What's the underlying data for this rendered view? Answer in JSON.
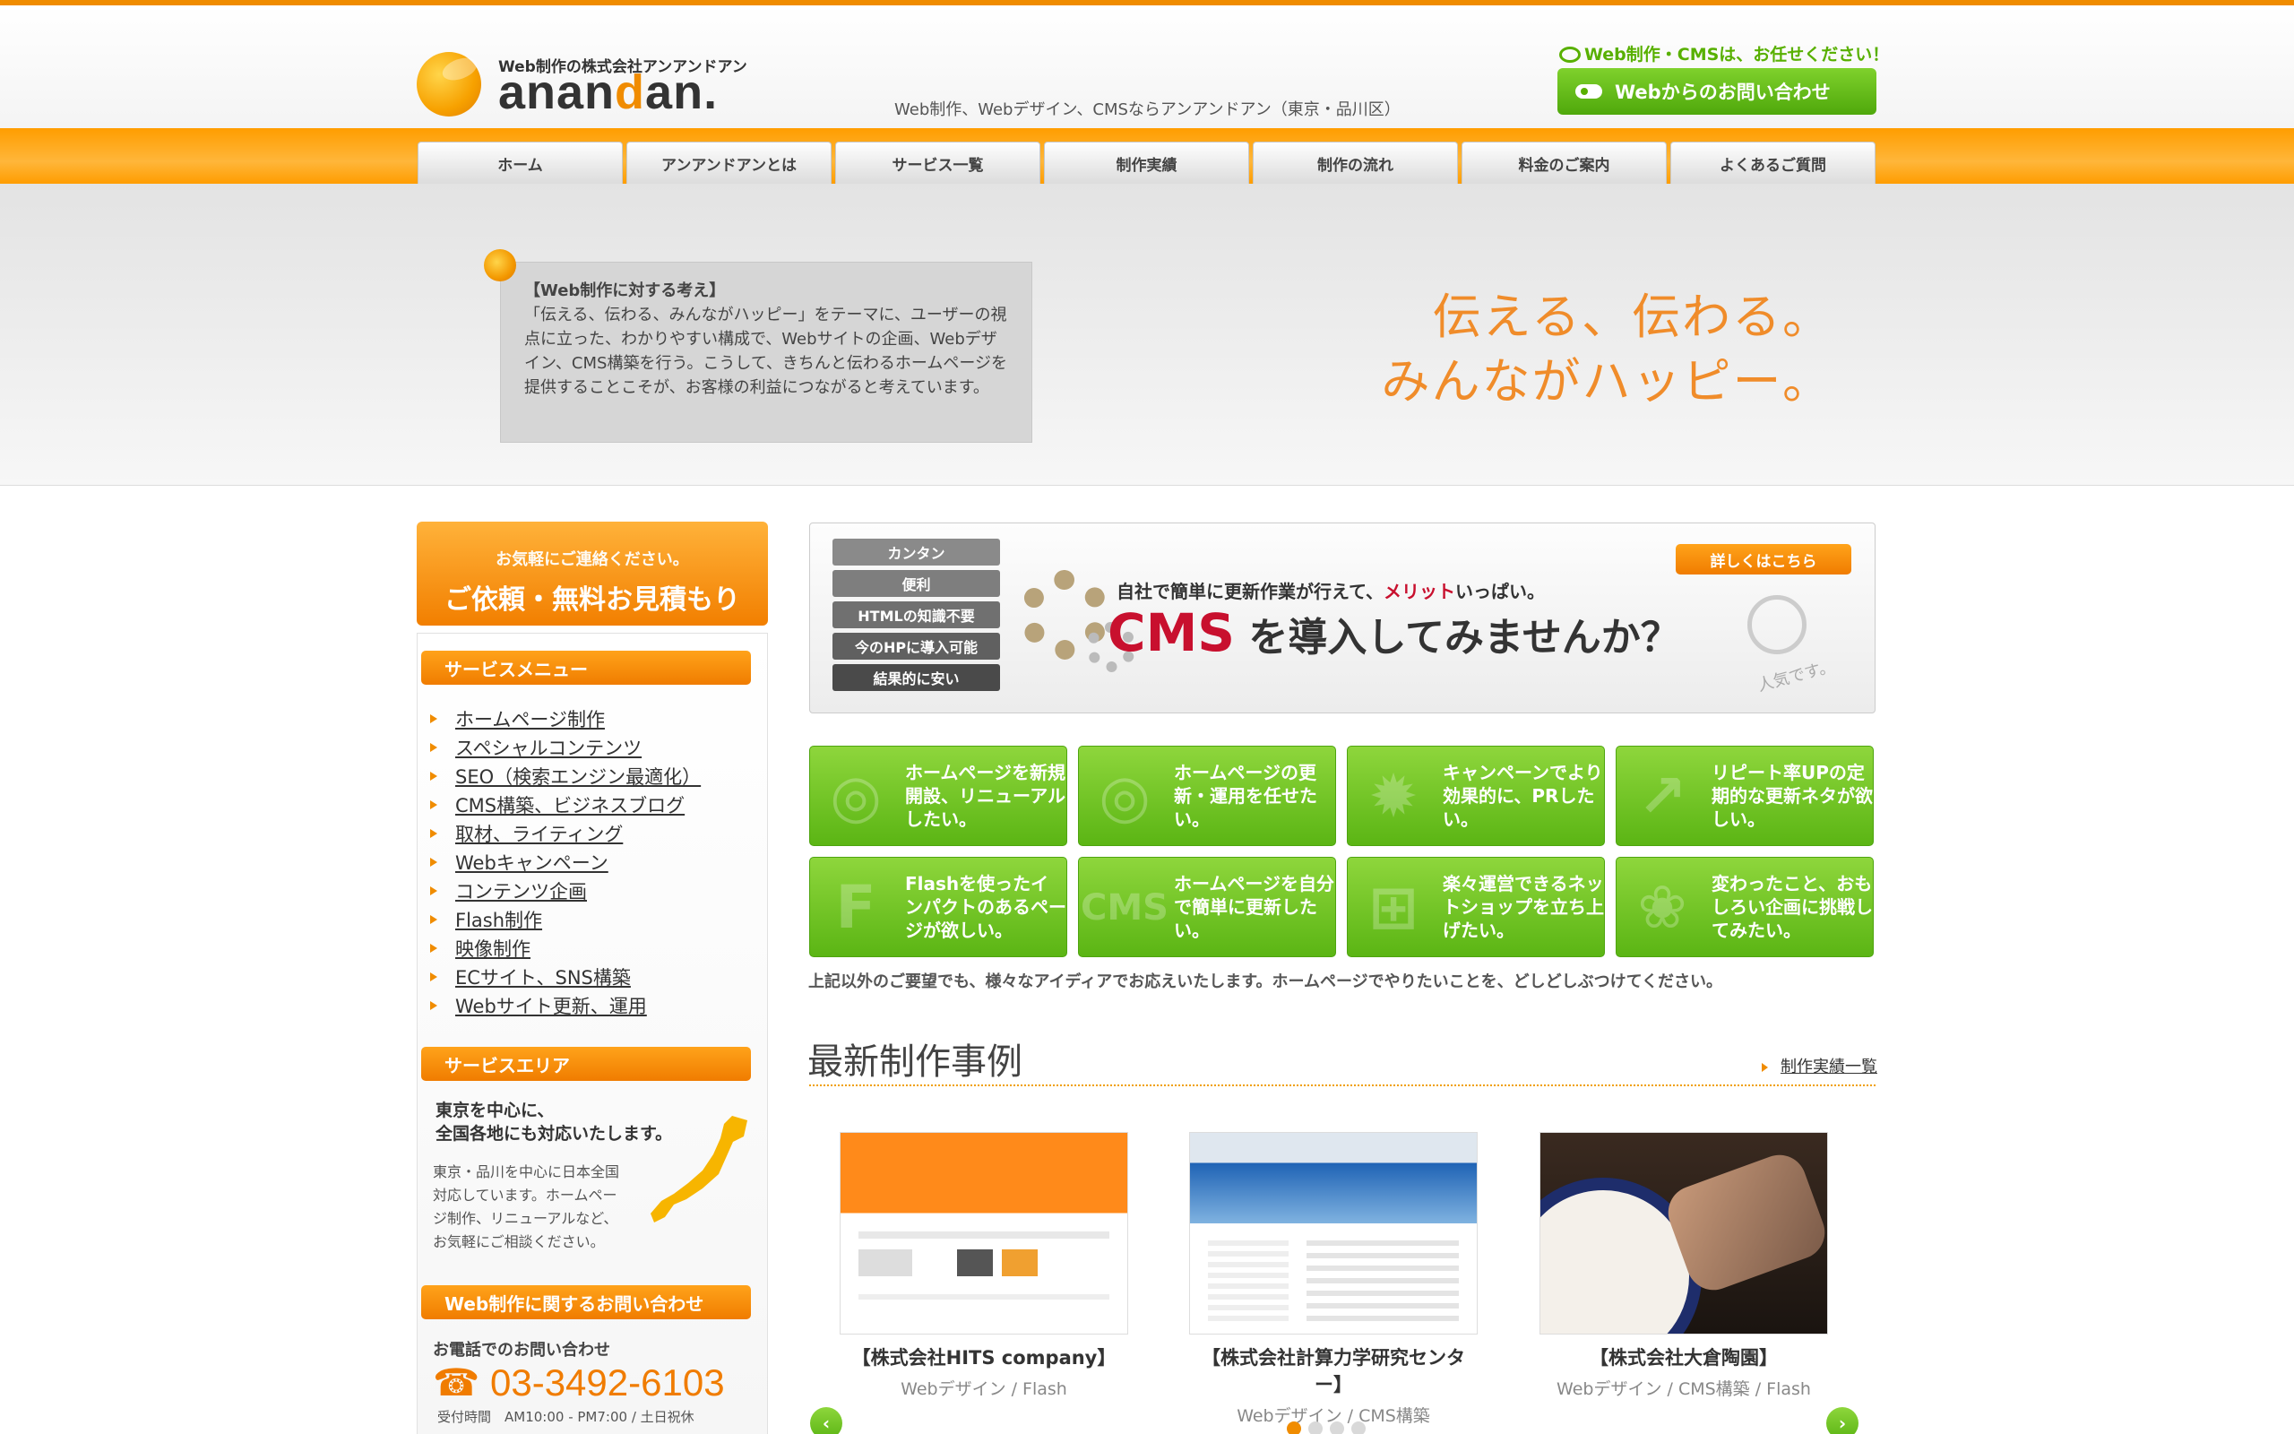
{
  "header": {
    "logo_tagline": "Web制作の株式会社アンアンドアン",
    "logo_part1": "anan",
    "logo_part2": "d",
    "logo_part3": "an.",
    "description": "Web制作、Webデザイン、CMSならアンアンドアン（東京・品川区）",
    "speech": "Web制作・CMSは、お任せください！",
    "contact_button": "Webからのお問い合わせ"
  },
  "nav": [
    "ホーム",
    "アンアンドアンとは",
    "サービス一覧",
    "制作実績",
    "制作の流れ",
    "料金のご案内",
    "よくあるご質問"
  ],
  "hero": {
    "box_title": "【Web制作に対する考え】",
    "box_text": "「伝える、伝わる、みんながハッピー」をテーマに、ユーザーの視点に立った、わかりやすい構成で、Webサイトの企画、Webデザイン、CMS構築を行う。こうして、きちんと伝わるホームページを提供することこそが、お客様の利益につながると考えています。",
    "copy_line1": "伝える、伝わる。",
    "copy_line2": "みんながハッピー。"
  },
  "sidebar": {
    "request_small": "お気軽にご連絡ください。",
    "request_big": "ご依頼・無料お見積もり",
    "service_menu_title": "サービスメニュー",
    "service_items": [
      "ホームページ制作",
      "スペシャルコンテンツ",
      "SEO（検索エンジン最適化）",
      "CMS構築、ビジネスブログ",
      "取材、ライティング",
      "Webキャンペーン",
      "コンテンツ企画",
      "Flash制作",
      "映像制作",
      "ECサイト、SNS構築",
      "Webサイト更新、運用"
    ],
    "area_title": "サービスエリア",
    "area_bold_1": "東京を中心に、",
    "area_bold_2": "全国各地にも対応いたします。",
    "area_text_1": "東京・品川を中心に日本全国",
    "area_text_2": "対応しています。ホームペー",
    "area_text_3": "ジ制作、リニューアルなど、",
    "area_text_4": "お気軽にご相談ください。",
    "contact_title": "Web制作に関するお問い合わせ",
    "tel_label": "お電話でのお問い合わせ",
    "tel_icon": "☎",
    "tel_number": "03-3492-6103",
    "tel_hours": "受付時間　AM10:00 - PM7:00 / 土日祝休"
  },
  "cms_banner": {
    "tags": [
      "カンタン",
      "便利",
      "HTMLの知識不要",
      "今のHPに導入可能",
      "結果的に安い"
    ],
    "sub_1": "自社で簡単に更新作業が行えて、",
    "sub_red": "メリット",
    "sub_2": "いっぱい。",
    "main_red": "CMS",
    "main": " を導入してみませんか？",
    "detail_button": "詳しくはこちら",
    "popular": "人気です。"
  },
  "tiles": [
    {
      "text": "ホームページを新規開設、リニューアルしたい。",
      "icon": "globe-icon",
      "glyph": "◎"
    },
    {
      "text": "ホームページの更新・運用を任せたい。",
      "icon": "refresh-globe-icon",
      "glyph": "◎"
    },
    {
      "text": "キャンペーンでより効果的に、PRしたい。",
      "icon": "burst-icon",
      "glyph": "✹"
    },
    {
      "text": "リピート率UPの定期的な更新ネタが欲しい。",
      "icon": "trend-arrow-icon",
      "glyph": "↗"
    },
    {
      "text": "Flashを使ったインパクトのあるページが欲しい。",
      "icon": "flash-icon",
      "glyph": "F"
    },
    {
      "text": "ホームページを自分で簡単に更新したい。",
      "icon": "cms-icon",
      "glyph": "CMS"
    },
    {
      "text": "楽々運営できるネットショップを立ち上げたい。",
      "icon": "cart-icon",
      "glyph": "⊞"
    },
    {
      "text": "変わったこと、おもしろい企画に挑戦してみたい。",
      "icon": "paw-icon",
      "glyph": "❀"
    }
  ],
  "tiles_note": "上記以外のご要望でも、様々なアイディアでお応えいたします。ホームページでやりたいことを、どしどしぶつけてください。",
  "works": {
    "title": "最新制作事例",
    "list_link": "制作実績一覧",
    "items": [
      {
        "caption": "【株式会社HITS company】",
        "sub": "Webデザイン / Flash"
      },
      {
        "caption": "【株式会社計算力学研究センター】",
        "sub": "Webデザイン / CMS構築"
      },
      {
        "caption": "【株式会社大倉陶園】",
        "sub": "Webデザイン / CMS構築 / Flash"
      }
    ],
    "prev": "‹",
    "next": "›"
  },
  "colors": {
    "brand_orange": "#f08c00",
    "accent_green": "#5bb514",
    "cms_red": "#c8102e"
  }
}
